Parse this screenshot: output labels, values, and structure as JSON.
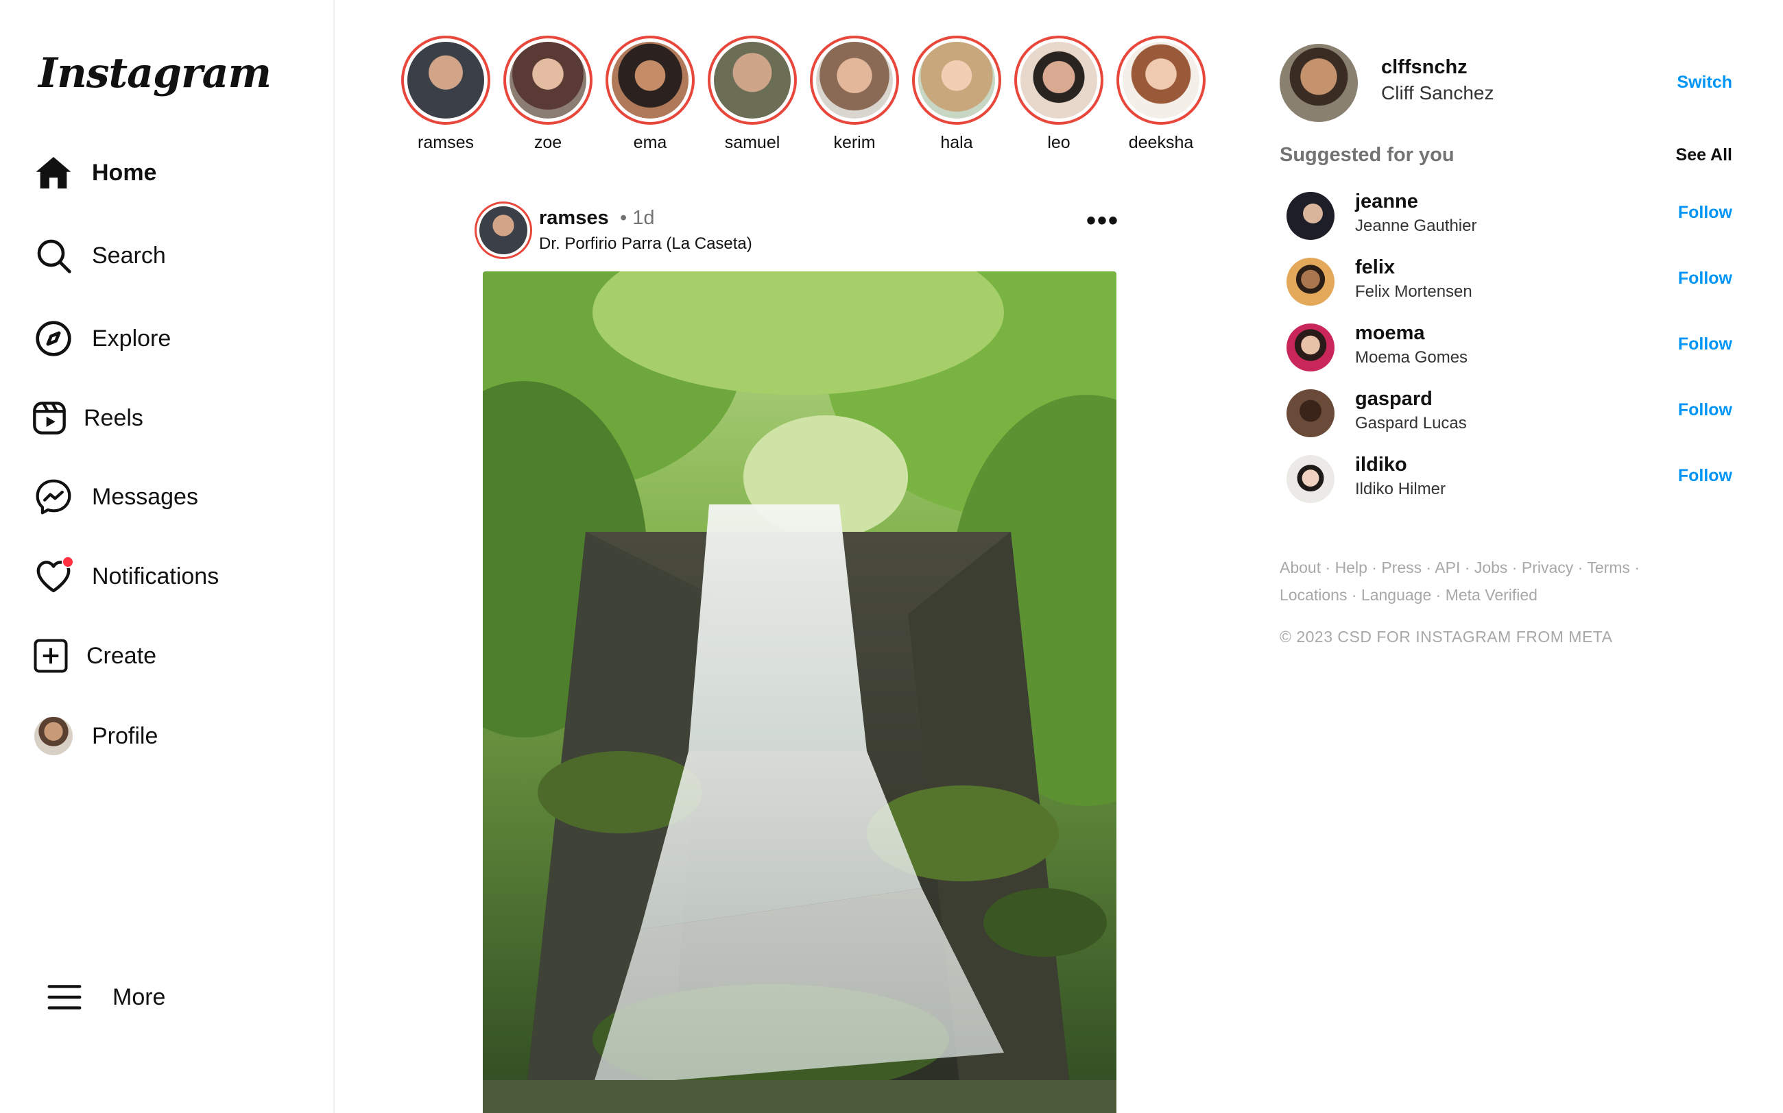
{
  "brand": {
    "logo_text": "Instagram"
  },
  "nav": {
    "items": [
      {
        "label": "Home",
        "icon": "home-icon"
      },
      {
        "label": "Search",
        "icon": "search-icon"
      },
      {
        "label": "Explore",
        "icon": "compass-icon"
      },
      {
        "label": "Reels",
        "icon": "reels-icon"
      },
      {
        "label": "Messages",
        "icon": "messenger-icon"
      },
      {
        "label": "Notifications",
        "icon": "heart-icon"
      },
      {
        "label": "Create",
        "icon": "plus-square-icon"
      },
      {
        "label": "Profile",
        "icon": "avatar"
      }
    ],
    "more_label": "More"
  },
  "stories": [
    {
      "name": "ramses",
      "color": "#3b3f47"
    },
    {
      "name": "zoe",
      "color": "#5a3a34"
    },
    {
      "name": "ema",
      "color": "#b07a5a"
    },
    {
      "name": "samuel",
      "color": "#6b6e55"
    },
    {
      "name": "kerim",
      "color": "#8a6a55"
    },
    {
      "name": "hala",
      "color": "#c9a77c"
    },
    {
      "name": "leo",
      "color": "#c4a38a"
    },
    {
      "name": "deeksha",
      "color": "#d7b49a"
    }
  ],
  "post": {
    "username": "ramses",
    "time": "• 1d",
    "location": "Dr. Porfirio Parra (La Caseta)",
    "more": "•••",
    "image_subject": "waterfall in a green forest"
  },
  "profile": {
    "username": "clffsnchz",
    "name": "Cliff Sanchez",
    "switch_label": "Switch"
  },
  "suggestions": {
    "title": "Suggested for you",
    "see_all": "See All",
    "follow_label": "Follow",
    "items": [
      {
        "username": "jeanne",
        "name": "Jeanne Gauthier",
        "color": "#2a2a35"
      },
      {
        "username": "felix",
        "name": "Felix Mortensen",
        "color": "#c98a3c"
      },
      {
        "username": "moema",
        "name": "Moema Gomes",
        "color": "#c9275a"
      },
      {
        "username": "gaspard",
        "name": "Gaspard Lucas",
        "color": "#4a2e22"
      },
      {
        "username": "ildiko",
        "name": "Ildiko Hilmer",
        "color": "#e8e4e0"
      }
    ]
  },
  "footer": {
    "links": [
      "About",
      "Help",
      "Press",
      "API",
      "Jobs",
      "Privacy",
      "Terms",
      "Locations",
      "Language",
      "Meta Verified"
    ],
    "copyright": "© 2023 CSD FOR INSTAGRAM FROM META"
  },
  "colors": {
    "story_ring": "#e8473c",
    "link_blue": "#0095f6",
    "notification_dot": "#ff3040"
  }
}
